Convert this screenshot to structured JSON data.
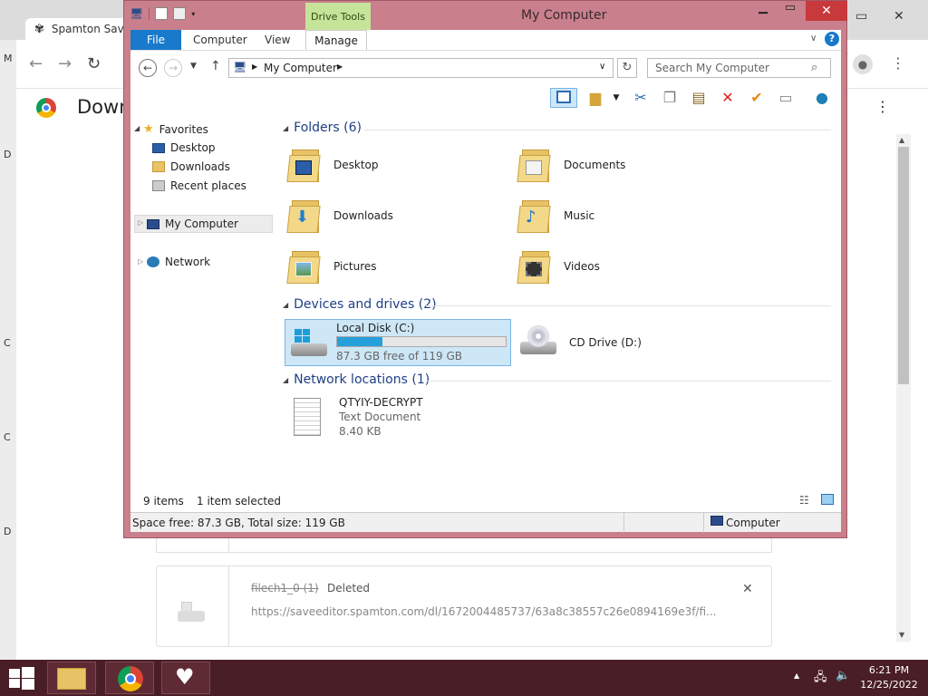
{
  "chrome": {
    "tab_title": "Spamton Save",
    "page_heading": "Down",
    "left_strip_letters": [
      "M",
      "D",
      "C",
      "C",
      "D"
    ],
    "download_item": {
      "filename": "filech1_0 (1)",
      "status": "Deleted",
      "url": "https://saveeditor.spamton.com/dl/1672004485737/63a8c38557c26e0894169e3f/fi..."
    }
  },
  "explorer": {
    "title": "My Computer",
    "drive_tools_label": "Drive Tools",
    "tabs": [
      "File",
      "Computer",
      "View",
      "Manage"
    ],
    "address": "My Computer",
    "search_placeholder": "Search My Computer",
    "nav": {
      "favorites": "Favorites",
      "fav_items": [
        "Desktop",
        "Downloads",
        "Recent places"
      ],
      "my_computer": "My Computer",
      "network": "Network"
    },
    "groups": {
      "folders": "Folders (6)",
      "devices": "Devices and drives (2)",
      "network": "Network locations (1)"
    },
    "folders": [
      "Desktop",
      "Documents",
      "Downloads",
      "Music",
      "Pictures",
      "Videos"
    ],
    "drives": {
      "c_name": "Local Disk (C:)",
      "c_free": "87.3 GB free of 119 GB",
      "c_used_fraction": 0.27,
      "d_name": "CD Drive (D:)"
    },
    "network_item": {
      "name": "QTYIY-DECRYPT",
      "type": "Text Document",
      "size": "8.40 KB"
    },
    "status": {
      "items": "9 items",
      "selected": "1 item selected",
      "space": "Space free: 87.3 GB, Total size: 119 GB",
      "zone": "Computer"
    }
  },
  "taskbar": {
    "time": "6:21 PM",
    "date": "12/25/2022"
  }
}
